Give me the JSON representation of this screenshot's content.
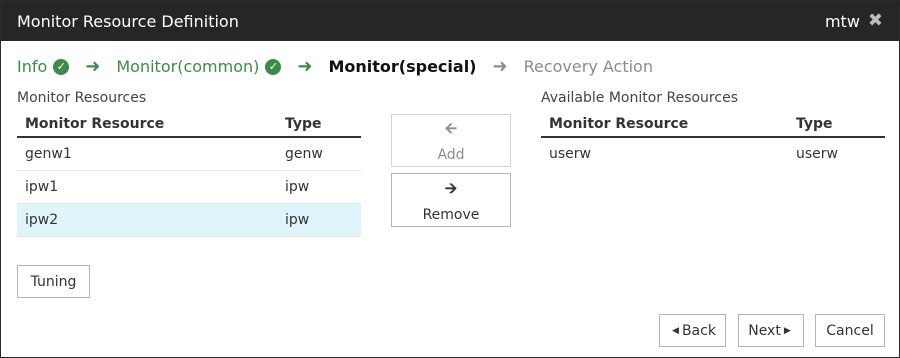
{
  "window": {
    "title": "Monitor Resource Definition",
    "user": "mtw",
    "close_icon": "close-icon"
  },
  "steps": [
    {
      "label": "Info",
      "state": "done"
    },
    {
      "label": "Monitor(common)",
      "state": "done"
    },
    {
      "label": "Monitor(special)",
      "state": "current"
    },
    {
      "label": "Recovery Action",
      "state": "todo"
    }
  ],
  "monitor_resources": {
    "heading": "Monitor Resources",
    "columns": [
      "Monitor Resource",
      "Type"
    ],
    "rows": [
      {
        "name": "genw1",
        "type": "genw"
      },
      {
        "name": "ipw1",
        "type": "ipw"
      },
      {
        "name": "ipw2",
        "type": "ipw",
        "selected": true
      }
    ]
  },
  "available_resources": {
    "heading": "Available Monitor Resources",
    "columns": [
      "Monitor Resource",
      "Type"
    ],
    "rows": [
      {
        "name": "userw",
        "type": "userw"
      }
    ]
  },
  "buttons": {
    "add": "Add",
    "remove": "Remove",
    "tuning": "Tuning",
    "back": "Back",
    "next": "Next",
    "cancel": "Cancel"
  },
  "colors": {
    "titlebar": "#262626",
    "done": "#3e8a4a",
    "selected_row": "#dff5fb"
  }
}
